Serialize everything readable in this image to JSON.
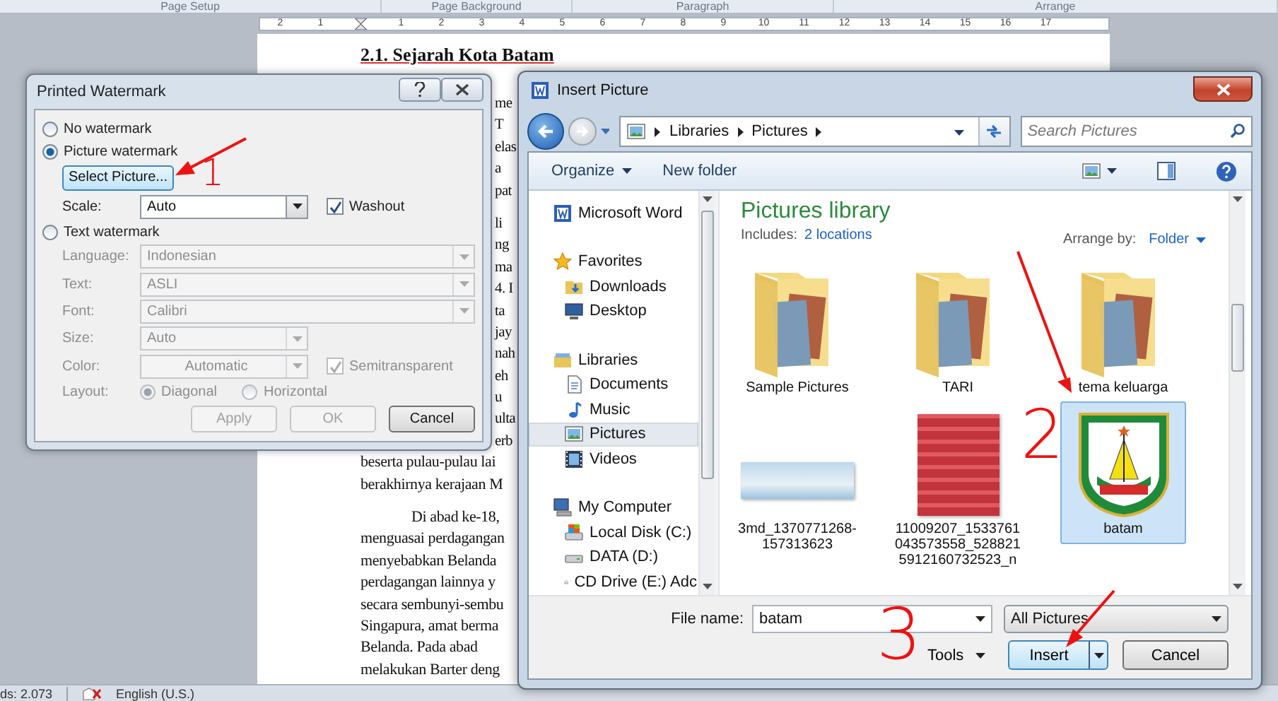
{
  "ribbon_groups": [
    "Page Setup",
    "Page Background",
    "Paragraph",
    "Arrange"
  ],
  "ruler": {
    "left_numbers": [
      "2",
      "1"
    ],
    "right_numbers": [
      "1",
      "2",
      "3",
      "4",
      "5",
      "6",
      "7",
      "8",
      "9",
      "10",
      "11",
      "12",
      "13",
      "14",
      "15",
      "16",
      "17"
    ]
  },
  "document": {
    "heading": "2.1. Sejarah Kota Batam",
    "paragraphs": [
      {
        "lines": [
          {
            "kind": "fragment",
            "text": "me"
          },
          {
            "kind": "fragment",
            "text": "T"
          },
          {
            "kind": "fragment",
            "text": "elas"
          },
          {
            "kind": "fragment",
            "text": "a"
          },
          {
            "kind": "fragment",
            "text": "pat"
          }
        ]
      },
      {
        "lines": [
          {
            "kind": "fragment",
            "text": "li"
          },
          {
            "kind": "fragment",
            "text": "ng"
          },
          {
            "kind": "fragment",
            "text": "ma"
          },
          {
            "kind": "fragment",
            "text": "4. I"
          },
          {
            "kind": "fragment",
            "text": "ta"
          },
          {
            "kind": "fragment",
            "text": "jay"
          },
          {
            "kind": "fragment",
            "text": "nah"
          },
          {
            "kind": "fragment",
            "text": "eh"
          },
          {
            "kind": "fragment",
            "text": "u"
          },
          {
            "kind": "fragment",
            "text": "ulta"
          },
          {
            "kind": "fragment",
            "text": "erb"
          },
          {
            "kind": "line",
            "text": "beserta pulau-pulau lai"
          },
          {
            "kind": "line",
            "text": "berakhirnya kerajaan M"
          }
        ]
      },
      {
        "lines": [
          {
            "kind": "indent",
            "text": "Di abad ke-18,"
          },
          {
            "kind": "line",
            "text": "menguasai perdagangan"
          },
          {
            "kind": "line",
            "text": "menyebabkan Belanda"
          },
          {
            "kind": "line",
            "text": "perdagangan lainnya y"
          },
          {
            "kind": "line",
            "text": "secara sembunyi-sembu"
          },
          {
            "kind": "line",
            "text": "Singapura, amat berma"
          },
          {
            "kind": "line",
            "text": "Belanda. Pada abad"
          },
          {
            "kind": "line",
            "text": "melakukan Barter deng"
          }
        ]
      }
    ]
  },
  "watermark_dialog": {
    "title": "Printed Watermark",
    "modes": [
      {
        "label": "No watermark",
        "selected": false
      },
      {
        "label": "Picture watermark",
        "selected": true
      },
      {
        "label": "Text watermark",
        "selected": false
      }
    ],
    "select_picture": "Select Picture...",
    "scale": {
      "label": "Scale:",
      "value": "Auto"
    },
    "washout": {
      "label": "Washout",
      "checked": true
    },
    "text_options": {
      "disabled": true,
      "fields": [
        {
          "label": "Language:",
          "value": "Indonesian",
          "kind": "wide"
        },
        {
          "label": "Text:",
          "value": "ASLI",
          "kind": "wide"
        },
        {
          "label": "Font:",
          "value": "Calibri",
          "kind": "wide"
        },
        {
          "label": "Size:",
          "value": "Auto",
          "kind": "narrow"
        },
        {
          "label": "Color:",
          "value": "Automatic",
          "kind": "color"
        }
      ],
      "semitransparent": {
        "label": "Semitransparent",
        "checked": true
      },
      "layout": {
        "label": "Layout:",
        "options": [
          {
            "label": "Diagonal",
            "selected": true
          },
          {
            "label": "Horizontal",
            "selected": false
          }
        ]
      }
    },
    "buttons": [
      {
        "label": "Apply",
        "disabled": true
      },
      {
        "label": "OK",
        "disabled": true
      },
      {
        "label": "Cancel",
        "disabled": false
      }
    ]
  },
  "insert_dialog": {
    "title": "Insert Picture",
    "breadcrumb": [
      "Libraries",
      "Pictures"
    ],
    "search_placeholder": "Search Pictures",
    "toolbar": [
      {
        "label": "Organize",
        "kind": "menu"
      },
      {
        "label": "New folder",
        "kind": "plain"
      }
    ],
    "sidebar": [
      {
        "label": "Microsoft Word",
        "kind": "word",
        "selected": false
      },
      {
        "label": "Favorites",
        "kind": "star",
        "selected": false,
        "children": [
          {
            "label": "Downloads",
            "kind": "downloads",
            "selected": false
          },
          {
            "label": "Desktop",
            "kind": "desktop",
            "selected": false
          }
        ]
      },
      {
        "label": "Libraries",
        "kind": "library",
        "selected": false,
        "children": [
          {
            "label": "Documents",
            "kind": "documents",
            "selected": false
          },
          {
            "label": "Music",
            "kind": "music",
            "selected": false
          },
          {
            "label": "Pictures",
            "kind": "pictures",
            "selected": true
          },
          {
            "label": "Videos",
            "kind": "videos",
            "selected": false
          }
        ]
      },
      {
        "label": "My Computer",
        "kind": "computer",
        "selected": false,
        "children": [
          {
            "label": "Local Disk (C:)",
            "kind": "disk",
            "selected": false
          },
          {
            "label": "DATA (D:)",
            "kind": "drive",
            "selected": false
          },
          {
            "label": "CD Drive (E:) Adc",
            "kind": "cd",
            "selected": false
          }
        ]
      }
    ],
    "library": {
      "title": "Pictures library",
      "includes_label": "Includes:",
      "includes_link": "2 locations",
      "arrange_label": "Arrange by:",
      "arrange_value": "Folder"
    },
    "items": [
      {
        "name": "Sample Pictures",
        "kind": "folder",
        "selected": false
      },
      {
        "name": "TARI",
        "kind": "folder",
        "selected": false
      },
      {
        "name": "tema keluarga",
        "kind": "folder",
        "selected": false
      },
      {
        "name": "3md_1370771268-157313623",
        "kind": "banner",
        "selected": false
      },
      {
        "name": "11009207_1533761043573558_5288215912160732523_n",
        "kind": "photo",
        "selected": false
      },
      {
        "name": "batam",
        "kind": "logo",
        "selected": true
      }
    ],
    "file_name": {
      "label": "File name:",
      "value": "batam"
    },
    "file_type": "All Pictures",
    "tools": "Tools",
    "buttons": [
      {
        "label": "Insert",
        "kind": "split"
      },
      {
        "label": "Cancel",
        "kind": "plain"
      }
    ]
  },
  "status_bar": {
    "word_count": "ds: 2.073",
    "language": "English (U.S.)"
  },
  "annotations": [
    {
      "text": "1"
    },
    {
      "text": "2"
    },
    {
      "text": "3"
    }
  ]
}
